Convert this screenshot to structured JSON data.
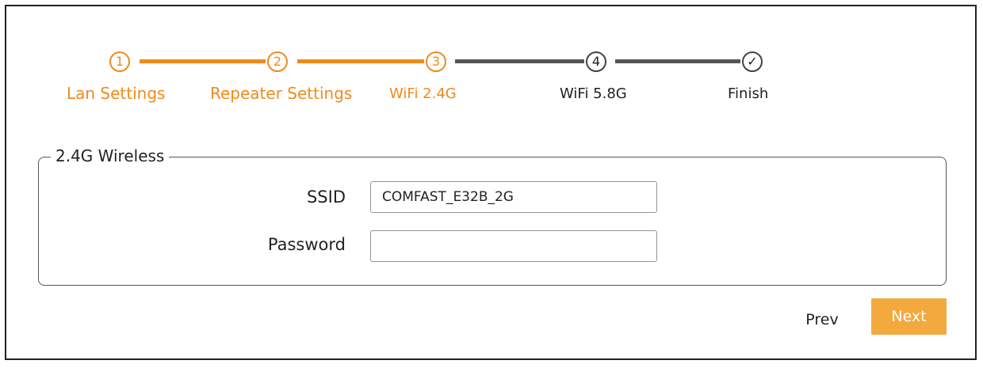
{
  "stepper": {
    "steps": [
      {
        "marker": "1",
        "label": "Lan Settings",
        "state": "done"
      },
      {
        "marker": "2",
        "label": "Repeater Settings",
        "state": "done"
      },
      {
        "marker": "3",
        "label": "WiFi 2.4G",
        "state": "current"
      },
      {
        "marker": "4",
        "label": "WiFi 5.8G",
        "state": "upcoming"
      },
      {
        "marker": "✓",
        "label": "Finish",
        "state": "upcoming"
      }
    ],
    "active_color": "#f08a1c",
    "inactive_color": "#444444"
  },
  "wireless": {
    "legend": "2.4G Wireless",
    "ssid_label": "SSID",
    "ssid_value": "COMFAST_E32B_2G",
    "password_label": "Password",
    "password_value": ""
  },
  "actions": {
    "prev_label": "Prev",
    "next_label": "Next",
    "next_color": "#f4a93f"
  }
}
